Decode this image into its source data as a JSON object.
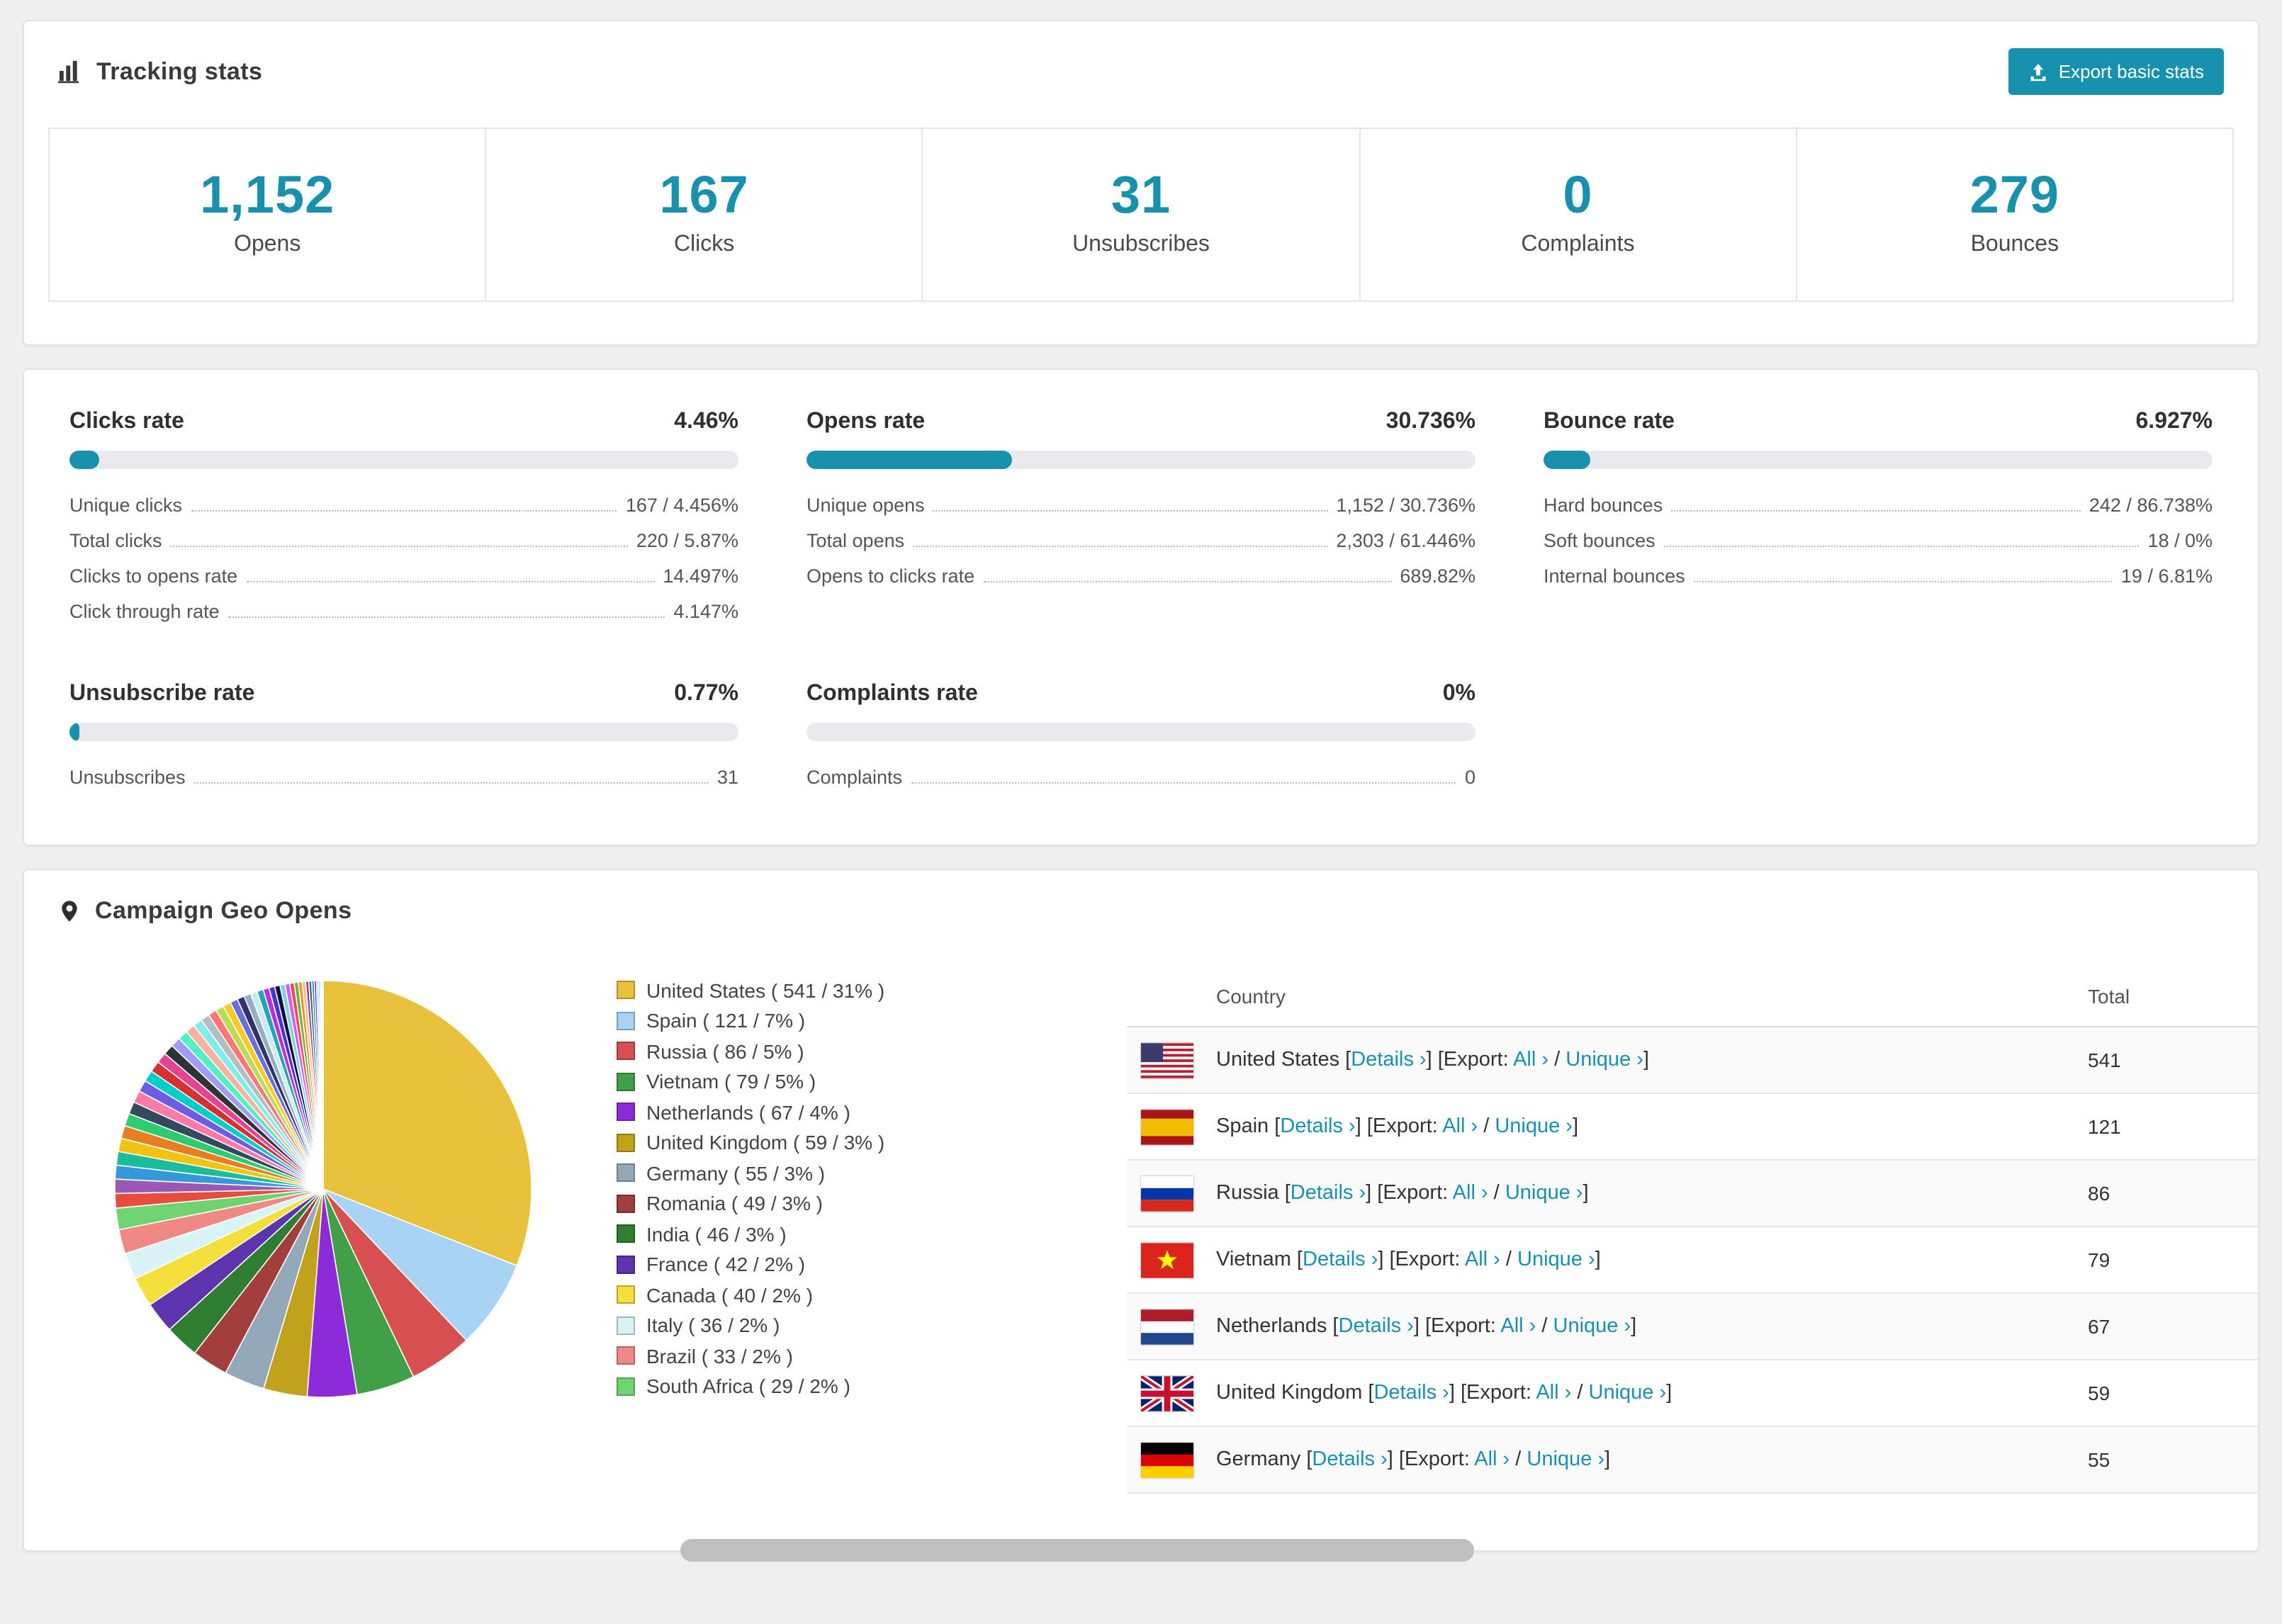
{
  "colors": {
    "accent": "#1791ad",
    "page_bg": "#f0f0f1"
  },
  "tracking": {
    "title": "Tracking stats",
    "export_button": "Export basic stats",
    "stats": [
      {
        "value": "1,152",
        "label": "Opens"
      },
      {
        "value": "167",
        "label": "Clicks"
      },
      {
        "value": "31",
        "label": "Unsubscribes"
      },
      {
        "value": "0",
        "label": "Complaints"
      },
      {
        "value": "279",
        "label": "Bounces"
      }
    ]
  },
  "rates": [
    {
      "title": "Clicks rate",
      "percent": "4.46%",
      "fill": 4.46,
      "rows": [
        {
          "label": "Unique clicks",
          "value": "167 / 4.456%"
        },
        {
          "label": "Total clicks",
          "value": "220 / 5.87%"
        },
        {
          "label": "Clicks to opens rate",
          "value": "14.497%"
        },
        {
          "label": "Click through rate",
          "value": "4.147%"
        }
      ]
    },
    {
      "title": "Opens rate",
      "percent": "30.736%",
      "fill": 30.736,
      "rows": [
        {
          "label": "Unique opens",
          "value": "1,152 / 30.736%"
        },
        {
          "label": "Total opens",
          "value": "2,303 / 61.446%"
        },
        {
          "label": "Opens to clicks rate",
          "value": "689.82%"
        }
      ]
    },
    {
      "title": "Bounce rate",
      "percent": "6.927%",
      "fill": 6.927,
      "rows": [
        {
          "label": "Hard bounces",
          "value": "242 / 86.738%"
        },
        {
          "label": "Soft bounces",
          "value": "18 / 0%"
        },
        {
          "label": "Internal bounces",
          "value": "19 / 6.81%"
        }
      ]
    },
    {
      "title": "Unsubscribe rate",
      "percent": "0.77%",
      "fill": 0.77,
      "rows": [
        {
          "label": "Unsubscribes",
          "value": "31"
        }
      ]
    },
    {
      "title": "Complaints rate",
      "percent": "0%",
      "fill": 0,
      "rows": [
        {
          "label": "Complaints",
          "value": "0"
        }
      ]
    }
  ],
  "geo": {
    "title": "Campaign Geo Opens",
    "table": {
      "headers": {
        "country": "Country",
        "total": "Total"
      },
      "details_label": "Details ›",
      "export_label": "Export:",
      "all_label": "All ›",
      "unique_label": "Unique ›",
      "rows": [
        {
          "name": "United States",
          "flag": "us",
          "total": "541"
        },
        {
          "name": "Spain",
          "flag": "es",
          "total": "121"
        },
        {
          "name": "Russia",
          "flag": "ru",
          "total": "86"
        },
        {
          "name": "Vietnam",
          "flag": "vn",
          "total": "79"
        },
        {
          "name": "Netherlands",
          "flag": "nl",
          "total": "67"
        },
        {
          "name": "United Kingdom",
          "flag": "gb",
          "total": "59"
        },
        {
          "name": "Germany",
          "flag": "de",
          "total": "55"
        }
      ]
    }
  },
  "chart_data": {
    "type": "pie",
    "title": "Campaign Geo Opens",
    "labels": [
      "United States",
      "Spain",
      "Russia",
      "Vietnam",
      "Netherlands",
      "United Kingdom",
      "Germany",
      "Romania",
      "India",
      "France",
      "Canada",
      "Italy",
      "Brazil",
      "South Africa"
    ],
    "values": [
      541,
      121,
      86,
      79,
      67,
      59,
      55,
      49,
      46,
      42,
      40,
      36,
      33,
      29
    ],
    "percent_labels": [
      "31%",
      "7%",
      "5%",
      "5%",
      "4%",
      "3%",
      "3%",
      "3%",
      "3%",
      "2%",
      "2%",
      "2%",
      "2%",
      "2%"
    ],
    "colors": [
      "#e9c23b",
      "#a9d3f5",
      "#d5504e",
      "#41a047",
      "#8e2bd8",
      "#c2a21b",
      "#93a9ba",
      "#a23e3c",
      "#2f7d31",
      "#5b34ae",
      "#f5df3d",
      "#d8f4f6",
      "#ef8984",
      "#6fd46f"
    ],
    "others_estimated_total": 462,
    "legend_position": "right"
  }
}
